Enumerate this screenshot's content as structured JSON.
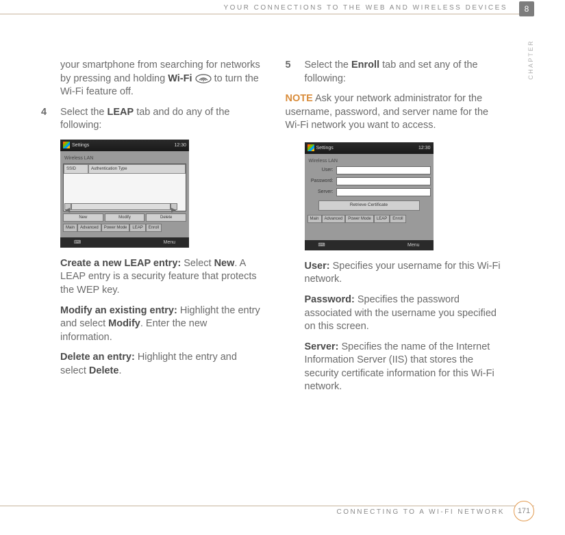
{
  "header": {
    "running_head": "YOUR CONNECTIONS TO THE WEB AND WIRELESS DEVICES",
    "chapter_badge": "8",
    "chapter_label": "CHAPTER"
  },
  "left_col": {
    "intro": "your smartphone from searching for networks by pressing and holding ",
    "intro_bold": "Wi-Fi",
    "intro_after": " to turn the Wi-Fi feature off.",
    "step4_num": "4",
    "step4_text_a": "Select the ",
    "step4_bold": "LEAP",
    "step4_text_b": " tab and do any of the following:",
    "ss1": {
      "topbar": "Settings",
      "time": "12:30",
      "title": "Wireless LAN",
      "col1": "SSID",
      "col2": "Authentication Type",
      "btns": [
        "New",
        "Modify",
        "Delete"
      ],
      "tabs": [
        "Main",
        "Advanced",
        "Power Mode",
        "LEAP",
        "Enroll"
      ],
      "menu": "Menu"
    },
    "create_bold": "Create a new LEAP entry:",
    "create_a": " Select ",
    "create_new": "New",
    "create_b": ". A LEAP entry is a security feature that protects the WEP key.",
    "modify_bold": "Modify an existing entry:",
    "modify_a": " Highlight the entry and select ",
    "modify_btn": "Modify",
    "modify_b": ". Enter the new information.",
    "delete_bold": "Delete an entry:",
    "delete_a": " Highlight the entry and select ",
    "delete_btn": "Delete",
    "delete_b": "."
  },
  "right_col": {
    "step5_num": "5",
    "step5_a": "Select the ",
    "step5_bold": "Enroll",
    "step5_b": " tab and set any of the following:",
    "note_label": "NOTE",
    "note_text": " Ask your network administrator for the username, password, and server name for the Wi-Fi network you want to access.",
    "ss2": {
      "topbar": "Settings",
      "time": "12:30",
      "title": "Wireless LAN",
      "user_lbl": "User:",
      "pw_lbl": "Password:",
      "server_lbl": "Server:",
      "retrieve": "Retrieve Certificate",
      "tabs": [
        "Main",
        "Advanced",
        "Power Mode",
        "LEAP",
        "Enroll"
      ],
      "menu": "Menu"
    },
    "user_bold": "User:",
    "user_text": " Specifies your username for this Wi-Fi network.",
    "pw_bold": "Password:",
    "pw_text": " Specifies the password associated with the username you specified on this screen.",
    "server_bold": "Server:",
    "server_text": " Specifies the name of the Internet Information Server (IIS) that stores the security certificate information for this Wi-Fi network."
  },
  "footer": {
    "text": "CONNECTING TO A WI-FI NETWORK",
    "page": "171"
  }
}
